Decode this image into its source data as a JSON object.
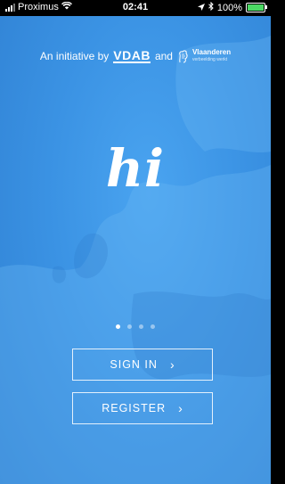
{
  "status_bar": {
    "carrier": "Proximus",
    "time": "02:41",
    "battery": "100%",
    "icons": [
      "signal-icon",
      "wifi-icon",
      "location-icon",
      "bluetooth-icon",
      "battery-icon"
    ]
  },
  "header": {
    "initiative_prefix": "An initiative by",
    "vdab": "VDAB",
    "and": "and",
    "vlaanderen": "Vlaanderen",
    "vlaanderen_sub": "verbeelding werkt"
  },
  "logo": {
    "text": "hi"
  },
  "pager": {
    "count": 4,
    "active_index": 0
  },
  "actions": {
    "sign_in": "SIGN IN",
    "register": "REGISTER",
    "chevron": "›"
  },
  "colors": {
    "background": "#3b93e4",
    "accent": "#ffffff"
  }
}
